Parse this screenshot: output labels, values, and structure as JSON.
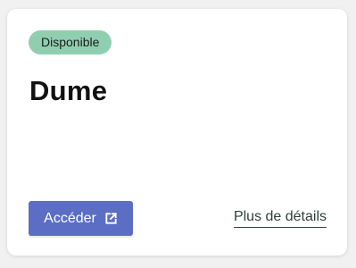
{
  "card": {
    "status_badge": "Disponible",
    "title": "Dume",
    "access_button_label": "Accéder",
    "details_link_label": "Plus de détails",
    "access_button_icon": "external-link-icon"
  },
  "colors": {
    "page_background": "#f1f1f1",
    "card_background": "#ffffff",
    "badge_background": "#8fcfb0",
    "button_background": "#5b6ec4",
    "link_text": "#2f3f38"
  }
}
